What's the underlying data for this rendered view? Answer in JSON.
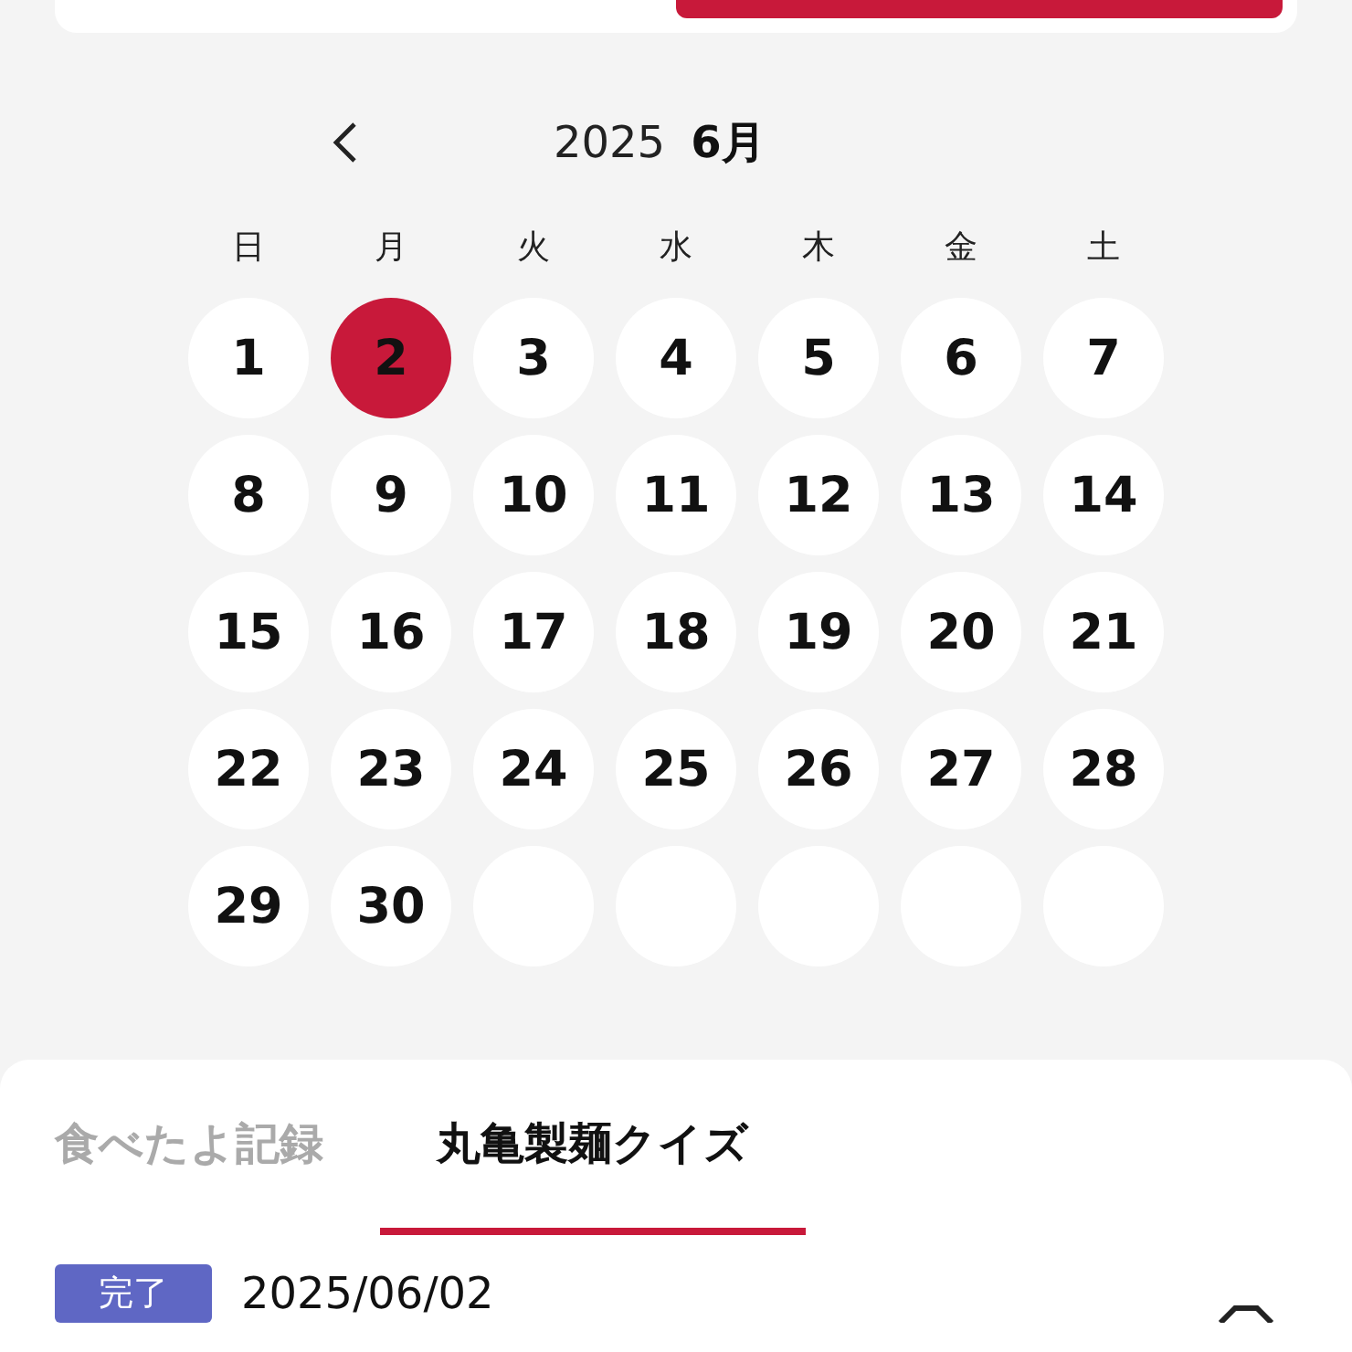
{
  "calendar": {
    "year": "2025",
    "month": "6月",
    "weekdays": [
      "日",
      "月",
      "火",
      "水",
      "木",
      "金",
      "土"
    ],
    "weeks": [
      [
        {
          "kind": "day",
          "label": "1",
          "selected": false
        },
        {
          "kind": "day",
          "label": "2",
          "selected": true
        },
        {
          "kind": "day",
          "label": "3",
          "selected": false
        },
        {
          "kind": "day",
          "label": "4",
          "selected": false
        },
        {
          "kind": "day",
          "label": "5",
          "selected": false
        },
        {
          "kind": "day",
          "label": "6",
          "selected": false
        },
        {
          "kind": "day",
          "label": "7",
          "selected": false
        }
      ],
      [
        {
          "kind": "day",
          "label": "8",
          "selected": false
        },
        {
          "kind": "day",
          "label": "9",
          "selected": false
        },
        {
          "kind": "day",
          "label": "10",
          "selected": false
        },
        {
          "kind": "day",
          "label": "11",
          "selected": false
        },
        {
          "kind": "day",
          "label": "12",
          "selected": false
        },
        {
          "kind": "day",
          "label": "13",
          "selected": false
        },
        {
          "kind": "day",
          "label": "14",
          "selected": false
        }
      ],
      [
        {
          "kind": "day",
          "label": "15",
          "selected": false
        },
        {
          "kind": "day",
          "label": "16",
          "selected": false
        },
        {
          "kind": "day",
          "label": "17",
          "selected": false
        },
        {
          "kind": "day",
          "label": "18",
          "selected": false
        },
        {
          "kind": "day",
          "label": "19",
          "selected": false
        },
        {
          "kind": "day",
          "label": "20",
          "selected": false
        },
        {
          "kind": "day",
          "label": "21",
          "selected": false
        }
      ],
      [
        {
          "kind": "day",
          "label": "22",
          "selected": false
        },
        {
          "kind": "day",
          "label": "23",
          "selected": false
        },
        {
          "kind": "day",
          "label": "24",
          "selected": false
        },
        {
          "kind": "day",
          "label": "25",
          "selected": false
        },
        {
          "kind": "day",
          "label": "26",
          "selected": false
        },
        {
          "kind": "day",
          "label": "27",
          "selected": false
        },
        {
          "kind": "day",
          "label": "28",
          "selected": false
        }
      ],
      [
        {
          "kind": "day",
          "label": "29",
          "selected": false
        },
        {
          "kind": "day",
          "label": "30",
          "selected": false
        },
        {
          "kind": "blank"
        },
        {
          "kind": "blank"
        },
        {
          "kind": "blank"
        },
        {
          "kind": "blank"
        },
        {
          "kind": "blank"
        }
      ]
    ]
  },
  "tabs": [
    {
      "label": "食べたよ記録",
      "selected": false
    },
    {
      "label": "丸亀製麺クイズ",
      "selected": true
    }
  ],
  "entries": [
    {
      "status": "完了",
      "date": "2025/06/02"
    }
  ]
}
